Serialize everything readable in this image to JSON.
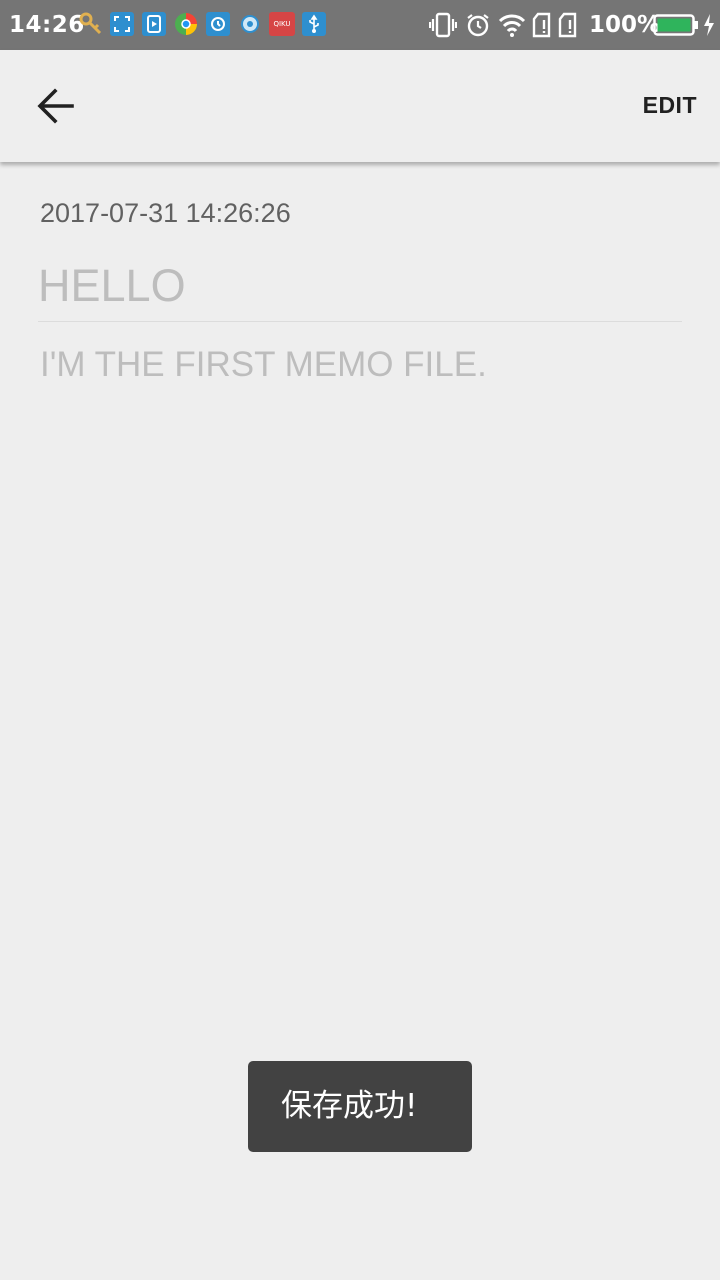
{
  "status_bar": {
    "time": "14:26",
    "battery_percent": "100%",
    "notification_icons": [
      "key-icon",
      "screenshot-icon",
      "video-icon",
      "browser-icon",
      "sync-icon",
      "compass-icon",
      "qiku-icon",
      "usb-icon"
    ],
    "qiku_label": "QIKU",
    "system_icons": [
      "vibrate-icon",
      "alarm-icon",
      "wifi-icon",
      "sim1-icon",
      "sim2-icon",
      "battery-icon",
      "charging-icon"
    ],
    "colors": {
      "background": "#757575",
      "battery_fill": "#2fb45c",
      "notification_blue": "#2e8fcf",
      "qiku_red": "#d64545"
    }
  },
  "toolbar": {
    "back_icon": "arrow-left-icon",
    "edit_label": "EDIT"
  },
  "memo": {
    "date": "2017-07-31 14:26:26",
    "title": "HELLO",
    "body": "I'M THE FIRST MEMO FILE."
  },
  "toast": {
    "message": "保存成功!"
  }
}
